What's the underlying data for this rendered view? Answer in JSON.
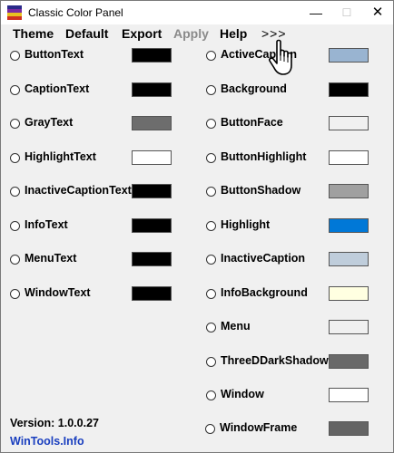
{
  "window": {
    "title": "Classic Color Panel",
    "minimize_glyph": "—",
    "maximize_glyph": "☐",
    "close_glyph": "✕"
  },
  "menu": [
    {
      "label": "Theme",
      "enabled": true
    },
    {
      "label": "Default",
      "enabled": true
    },
    {
      "label": "Export",
      "enabled": true
    },
    {
      "label": "Apply",
      "enabled": false
    },
    {
      "label": "Help",
      "enabled": true
    },
    {
      "label": ">>>",
      "enabled": true
    }
  ],
  "left_colors": [
    {
      "label": "ButtonText",
      "color": "#000000"
    },
    {
      "label": "CaptionText",
      "color": "#000000"
    },
    {
      "label": "GrayText",
      "color": "#6d6d6d"
    },
    {
      "label": "HighlightText",
      "color": "#ffffff"
    },
    {
      "label": "InactiveCaptionText",
      "color": "#000000"
    },
    {
      "label": "InfoText",
      "color": "#000000"
    },
    {
      "label": "MenuText",
      "color": "#000000"
    },
    {
      "label": "WindowText",
      "color": "#000000"
    }
  ],
  "right_colors": [
    {
      "label": "ActiveCaption",
      "color": "#99b4d1"
    },
    {
      "label": "Background",
      "color": "#000000"
    },
    {
      "label": "ButtonFace",
      "color": "#f0f0f0"
    },
    {
      "label": "ButtonHighlight",
      "color": "#ffffff"
    },
    {
      "label": "ButtonShadow",
      "color": "#a0a0a0"
    },
    {
      "label": "Highlight",
      "color": "#0078d7"
    },
    {
      "label": "InactiveCaption",
      "color": "#bfcddb"
    },
    {
      "label": "InfoBackground",
      "color": "#ffffe1"
    },
    {
      "label": "Menu",
      "color": "#f0f0f0"
    },
    {
      "label": "ThreeDDarkShadow",
      "color": "#696969"
    },
    {
      "label": "Window",
      "color": "#ffffff"
    },
    {
      "label": "WindowFrame",
      "color": "#646464"
    }
  ],
  "footer": {
    "version": "Version: 1.0.0.27",
    "link": "WinTools.Info",
    "link_color": "#1a3fbf"
  }
}
